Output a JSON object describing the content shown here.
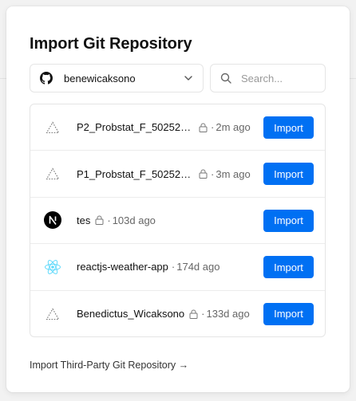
{
  "title": "Import Git Repository",
  "account": {
    "name": "benewicaksono",
    "icon": "github-icon"
  },
  "search": {
    "placeholder": "Search...",
    "value": ""
  },
  "repos": [
    {
      "name": "P2_Probstat_F_5025201...",
      "private": true,
      "age": "2m ago",
      "icon": "triangle-dotted-icon",
      "button": "Import"
    },
    {
      "name": "P1_Probstat_F_5025201...",
      "private": true,
      "age": "3m ago",
      "icon": "triangle-dotted-icon",
      "button": "Import"
    },
    {
      "name": "tes",
      "private": true,
      "age": "103d ago",
      "icon": "nextjs-icon",
      "button": "Import"
    },
    {
      "name": "reactjs-weather-app",
      "private": false,
      "age": "174d ago",
      "icon": "react-icon",
      "button": "Import"
    },
    {
      "name": "Benedictus_Wicaksono",
      "private": true,
      "age": "133d ago",
      "icon": "triangle-dotted-icon",
      "button": "Import"
    }
  ],
  "separator": "·",
  "third_party_link": "Import Third-Party Git Repository →",
  "colors": {
    "accent": "#0070f3",
    "border": "#e5e5e5",
    "muted": "#666666"
  }
}
